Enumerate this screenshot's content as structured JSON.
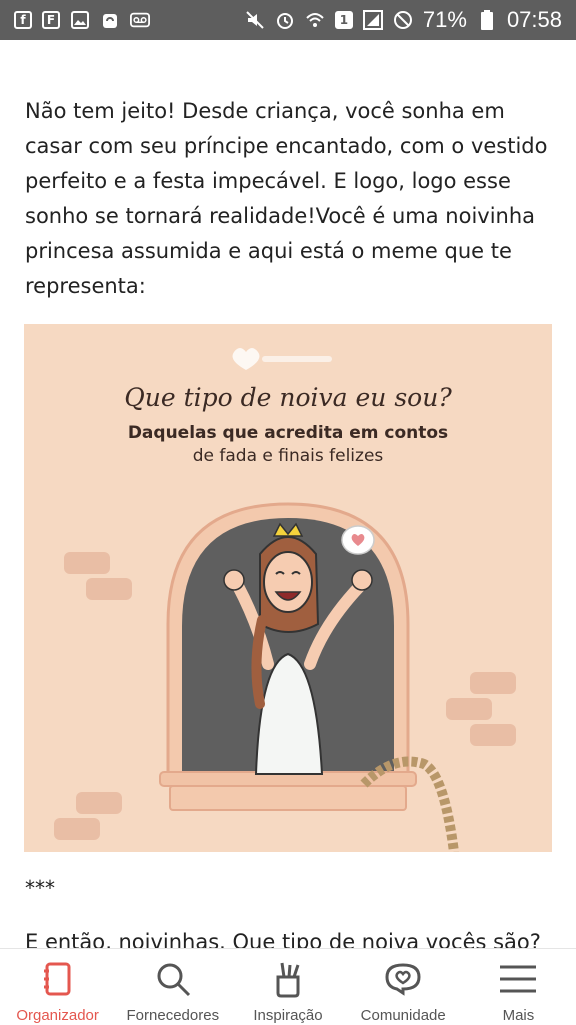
{
  "status_bar": {
    "battery_percent": "71%",
    "time": "07:58",
    "left_icons": [
      "facebook-icon",
      "flipboard-icon",
      "image-icon",
      "recycle-icon",
      "voicemail-icon"
    ],
    "right_icons": [
      "mute-icon",
      "alarm-icon",
      "wifi-icon",
      "sim-icon",
      "signal-icon",
      "dnd-icon",
      "battery-icon"
    ],
    "sim_number": "1"
  },
  "article": {
    "paragraph": "Não tem jeito! Desde criança, você sonha em casar com seu príncipe encantado, com o vestido perfeito e a festa impecável. E logo, logo esse sonho se tornará realidade!Você é uma noivinha princesa assumida e aqui está o meme que te representa:",
    "separator": "***",
    "next_paragraph_cut": "E então, noivinhas. Que tipo de noiva vocês são?"
  },
  "meme": {
    "title": "Que tipo de noiva eu sou?",
    "subtitle_line1": "Daquelas que acredita em contos",
    "subtitle_line2": "de fada e finais felizes",
    "background_color": "#f6d9c2"
  },
  "tabbar": {
    "active_color": "#e4574f",
    "items": [
      {
        "label": "Organizador",
        "icon": "planner-icon",
        "active": true
      },
      {
        "label": "Fornecedores",
        "icon": "search-icon",
        "active": false
      },
      {
        "label": "Inspiração",
        "icon": "paint-brushes-icon",
        "active": false
      },
      {
        "label": "Comunidade",
        "icon": "heart-chat-icon",
        "active": false
      },
      {
        "label": "Mais",
        "icon": "menu-icon",
        "active": false
      }
    ]
  }
}
